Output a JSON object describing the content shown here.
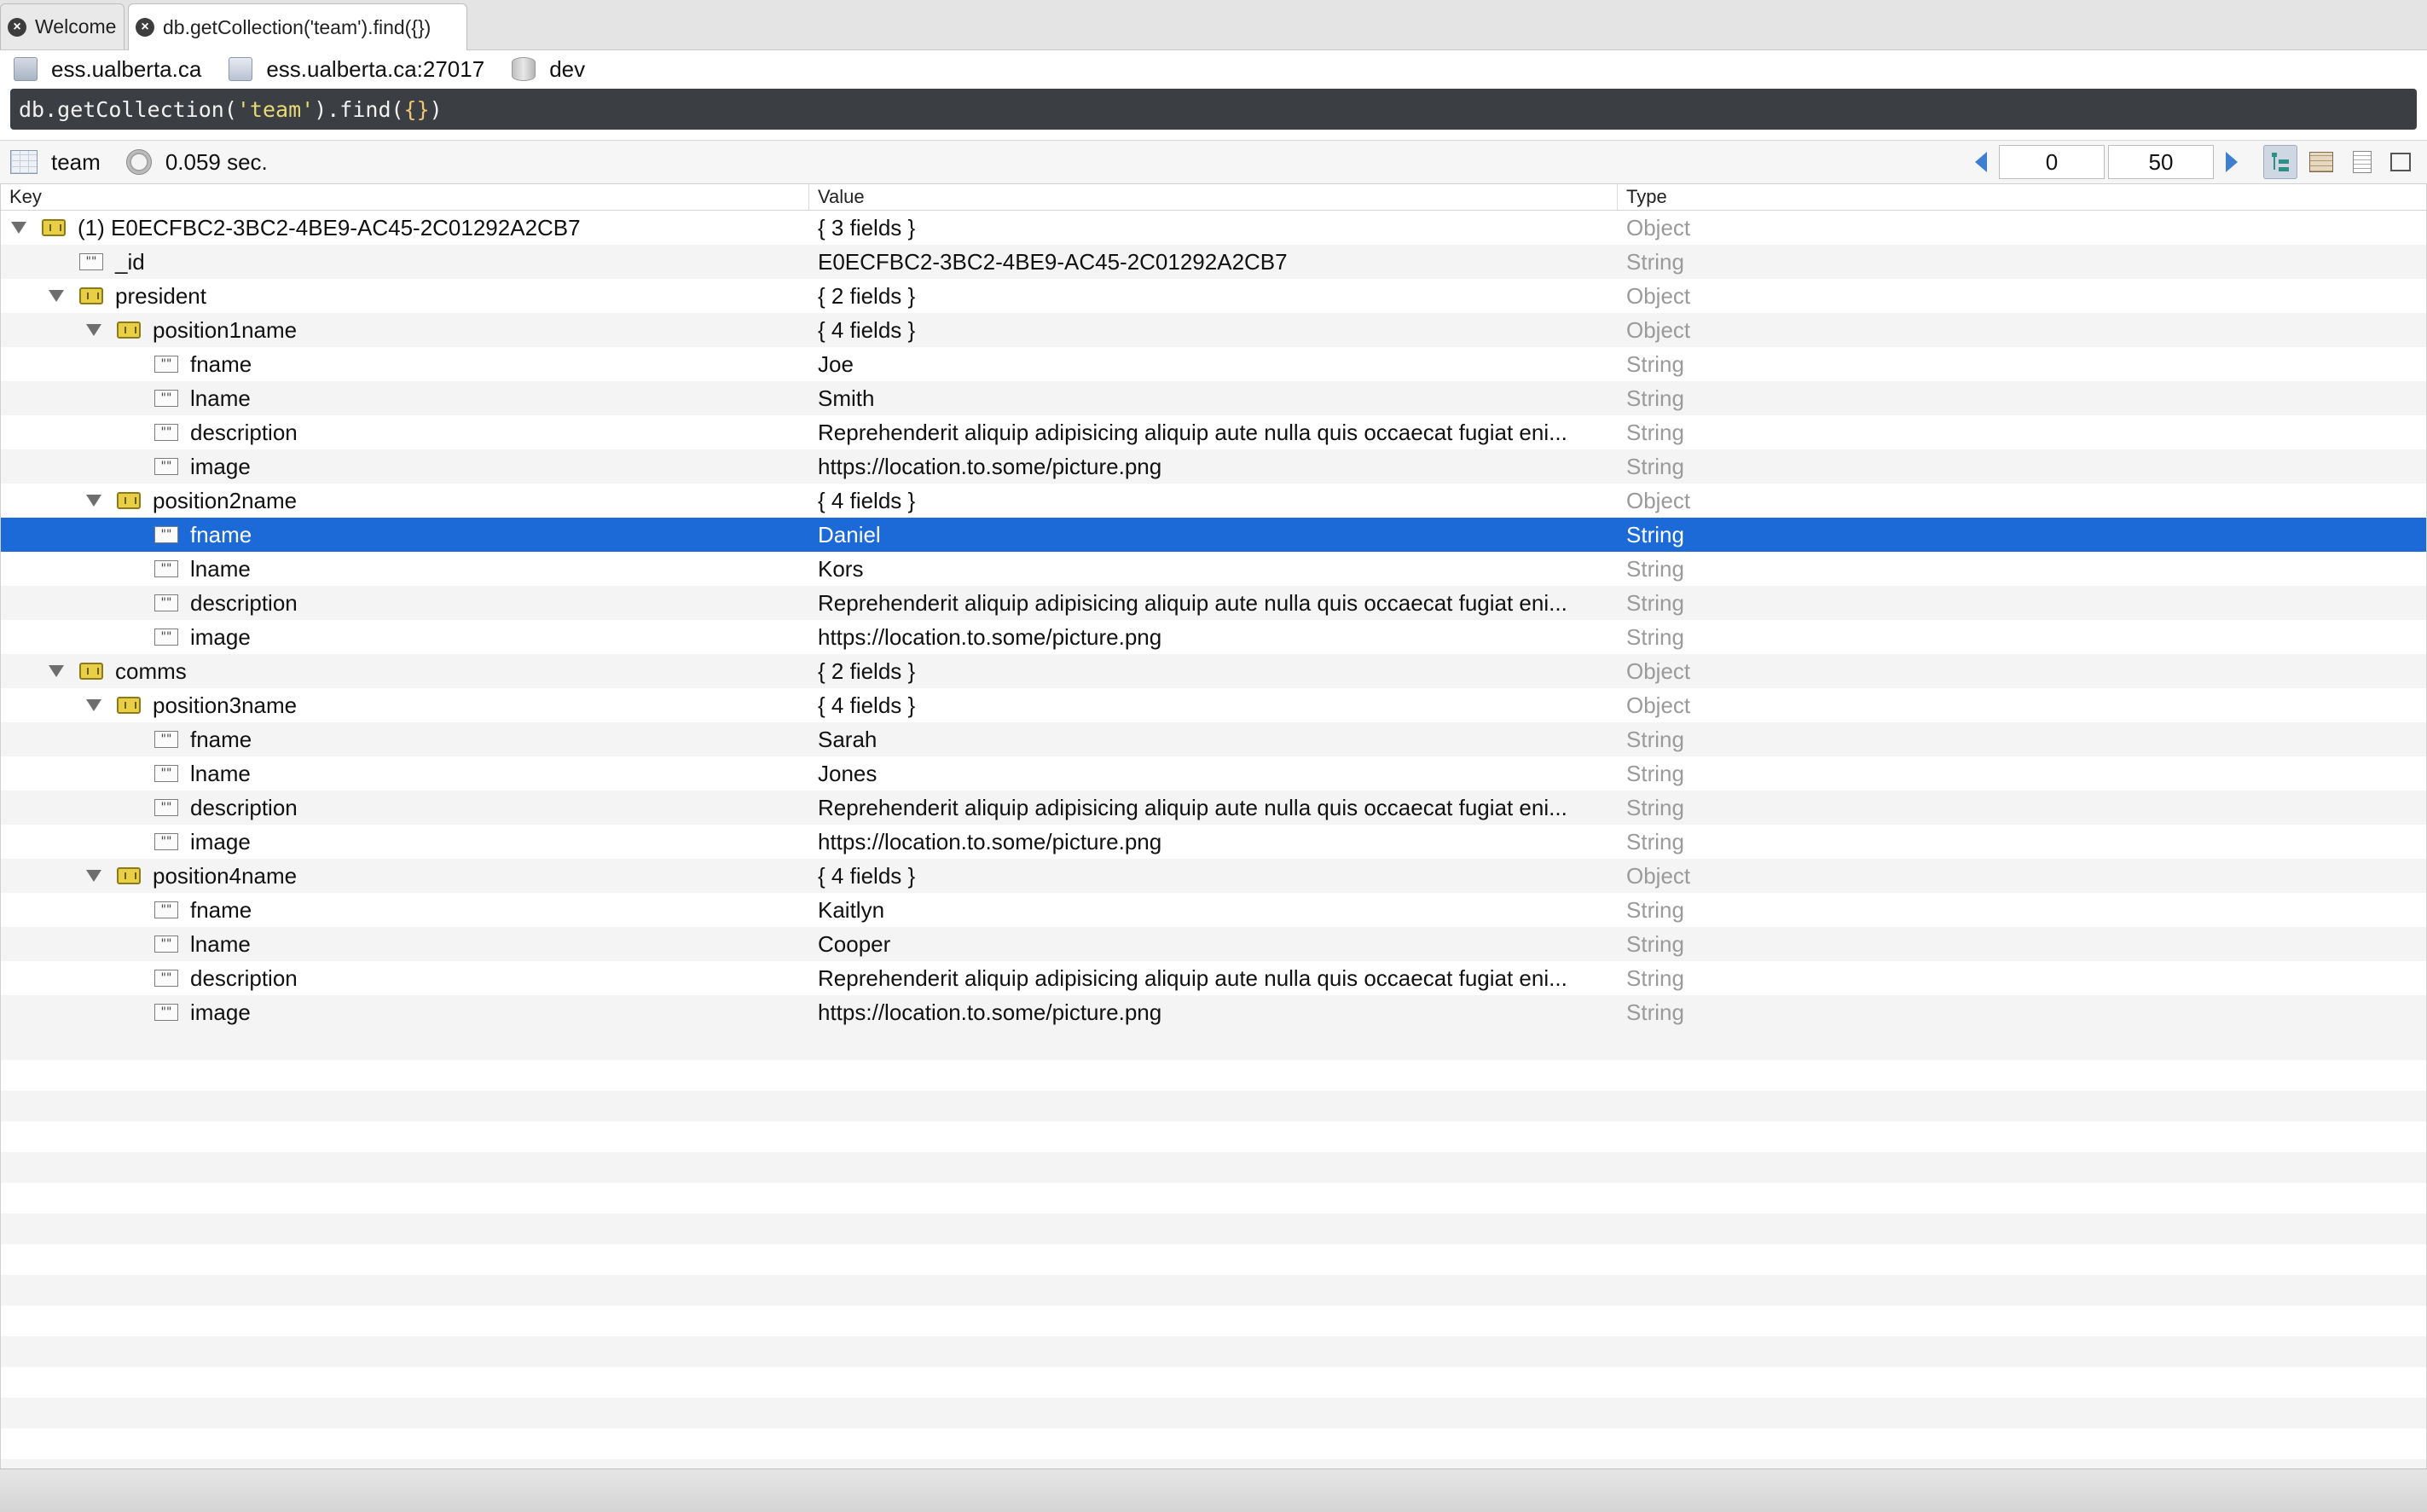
{
  "tabs": [
    {
      "label": "Welcome",
      "active": false
    },
    {
      "label": "db.getCollection('team').find({})",
      "active": true
    }
  ],
  "connection": {
    "server": "ess.ualberta.ca",
    "host": "ess.ualberta.ca:27017",
    "database": "dev"
  },
  "query": {
    "prefix": "db.getCollection(",
    "collection_arg": "'team'",
    "mid": ").find(",
    "filter_arg": "{}",
    "suffix": ")"
  },
  "result": {
    "collection": "team",
    "elapsed": "0.059 sec.",
    "skip": "0",
    "limit": "50"
  },
  "columns": {
    "key": "Key",
    "value": "Value",
    "type": "Type"
  },
  "rows": [
    {
      "key": "(1) E0ECFBC2-3BC2-4BE9-AC45-2C01292A2CB7",
      "value": "{ 3 fields }",
      "type": "Object"
    },
    {
      "key": "_id",
      "value": "E0ECFBC2-3BC2-4BE9-AC45-2C01292A2CB7",
      "type": "String"
    },
    {
      "key": "president",
      "value": "{ 2 fields }",
      "type": "Object"
    },
    {
      "key": "position1name",
      "value": "{ 4 fields }",
      "type": "Object"
    },
    {
      "key": "fname",
      "value": "Joe",
      "type": "String"
    },
    {
      "key": "lname",
      "value": "Smith",
      "type": "String"
    },
    {
      "key": "description",
      "value": "Reprehenderit aliquip adipisicing aliquip aute nulla quis occaecat fugiat eni...",
      "type": "String"
    },
    {
      "key": "image",
      "value": "https://location.to.some/picture.png",
      "type": "String"
    },
    {
      "key": "position2name",
      "value": "{ 4 fields }",
      "type": "Object"
    },
    {
      "key": "fname",
      "value": "Daniel",
      "type": "String"
    },
    {
      "key": "lname",
      "value": "Kors",
      "type": "String"
    },
    {
      "key": "description",
      "value": "Reprehenderit aliquip adipisicing aliquip aute nulla quis occaecat fugiat eni...",
      "type": "String"
    },
    {
      "key": "image",
      "value": "https://location.to.some/picture.png",
      "type": "String"
    },
    {
      "key": "comms",
      "value": "{ 2 fields }",
      "type": "Object"
    },
    {
      "key": "position3name",
      "value": "{ 4 fields }",
      "type": "Object"
    },
    {
      "key": "fname",
      "value": "Sarah",
      "type": "String"
    },
    {
      "key": "lname",
      "value": "Jones",
      "type": "String"
    },
    {
      "key": "description",
      "value": "Reprehenderit aliquip adipisicing aliquip aute nulla quis occaecat fugiat eni...",
      "type": "String"
    },
    {
      "key": "image",
      "value": "https://location.to.some/picture.png",
      "type": "String"
    },
    {
      "key": "position4name",
      "value": "{ 4 fields }",
      "type": "Object"
    },
    {
      "key": "fname",
      "value": "Kaitlyn",
      "type": "String"
    },
    {
      "key": "lname",
      "value": "Cooper",
      "type": "String"
    },
    {
      "key": "description",
      "value": "Reprehenderit aliquip adipisicing aliquip aute nulla quis occaecat fugiat eni...",
      "type": "String"
    },
    {
      "key": "image",
      "value": "https://location.to.some/picture.png",
      "type": "String"
    }
  ],
  "selected_row": 9,
  "colors": {
    "selection": "#1b6ad7",
    "object_icon": "#e9cf45",
    "pager_arrow": "#3f7fd0"
  },
  "icons": {
    "object": "object-icon",
    "string": "string-icon"
  }
}
